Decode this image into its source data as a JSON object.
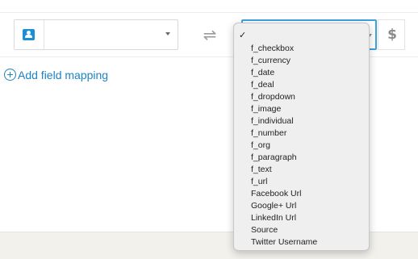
{
  "mapping_row": {
    "left_select": {
      "entity_icon": "person-card-icon",
      "value": ""
    },
    "swap_icon": "swap-arrows-icon",
    "right_select": {
      "value": ""
    },
    "field_type_icon": "currency-icon",
    "field_type_glyph": "$"
  },
  "add_field_mapping": {
    "label": "Add field mapping",
    "icon": "plus-circle-icon"
  },
  "dropdown": {
    "selected_index": 0,
    "options": [
      "",
      "f_checkbox",
      "f_currency",
      "f_date",
      "f_deal",
      "f_dropdown",
      "f_image",
      "f_individual",
      "f_number",
      "f_org",
      "f_paragraph",
      "f_text",
      "f_url",
      "Facebook Url",
      "Google+ Url",
      "LinkedIn Url",
      "Source",
      "Twitter Username"
    ]
  },
  "colors": {
    "accent": "#1c83c6",
    "focus_border": "#3aa3dc",
    "entity_icon": "#1a8fd6",
    "footer_band": "#f2f1ec"
  }
}
